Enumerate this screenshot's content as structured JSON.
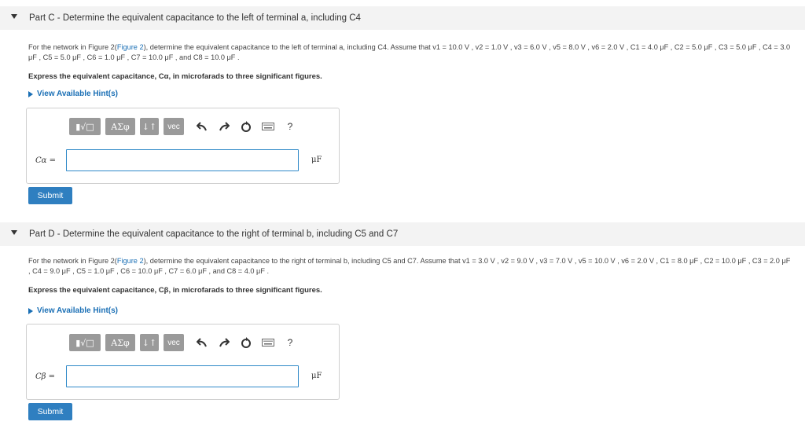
{
  "part_c": {
    "label": "Part C",
    "title": "Determine the equivalent capacitance to the left of terminal a, including C4",
    "text_pre": "For the network in Figure 2(",
    "figure_link": "Figure 2",
    "text_post": "), determine the equivalent capacitance to the left of terminal a, including C4. Assume that v1 = 10.0 V , v2 = 1.0 V , v3 = 6.0 V , v5 = 8.0 V , v6 = 2.0 V , C1 = 4.0 μF , C2 = 5.0 μF , C3 = 5.0 μF , C4 = 3.0 μF , C5 = 5.0 μF , C6 = 1.0 μF , C7 = 10.0 μF , and C8 = 10.0 μF .",
    "prompt": "Express the equivalent capacitance, Cα, in microfarads to three significant figures.",
    "hint_label": "View Available Hint(s)",
    "variable_label": "Cα =",
    "answer_value": "",
    "unit": "μF",
    "submit_label": "Submit"
  },
  "part_d": {
    "label": "Part D",
    "title": "Determine the equivalent capacitance to the right of terminal b, including C5 and C7",
    "text_pre": "For the network in Figure 2(",
    "figure_link": "Figure 2",
    "text_post": "), determine the equivalent capacitance to the right of terminal b, including C5 and C7. Assume that v1 = 3.0 V , v2 = 9.0 V , v3 = 7.0 V , v5 = 10.0 V , v6 = 2.0 V , C1 = 8.0 μF , C2 = 10.0 μF , C3 = 2.0 μF , C4 = 9.0 μF , C5 = 1.0 μF , C6 = 10.0 μF , C7 = 6.0 μF , and C8 = 4.0 μF .",
    "prompt": "Express the equivalent capacitance, Cβ, in microfarads to three significant figures.",
    "hint_label": "View Available Hint(s)",
    "variable_label": "Cβ =",
    "answer_value": "",
    "unit": "μF",
    "submit_label": "Submit"
  },
  "toolbar": {
    "templates_label": "▮√□",
    "symbols_label": "ΑΣφ",
    "arrows_label": "↓↑",
    "vec_label": "vec",
    "help_label": "?",
    "icons": [
      "templates-icon",
      "symbols-icon",
      "updown-icon",
      "vector-icon",
      "undo-icon",
      "redo-icon",
      "reset-icon",
      "keyboard-icon",
      "help-icon"
    ]
  },
  "colors": {
    "accent": "#2f7fc0",
    "link": "#1a6fb5",
    "header_bg": "#f3f3f3"
  }
}
